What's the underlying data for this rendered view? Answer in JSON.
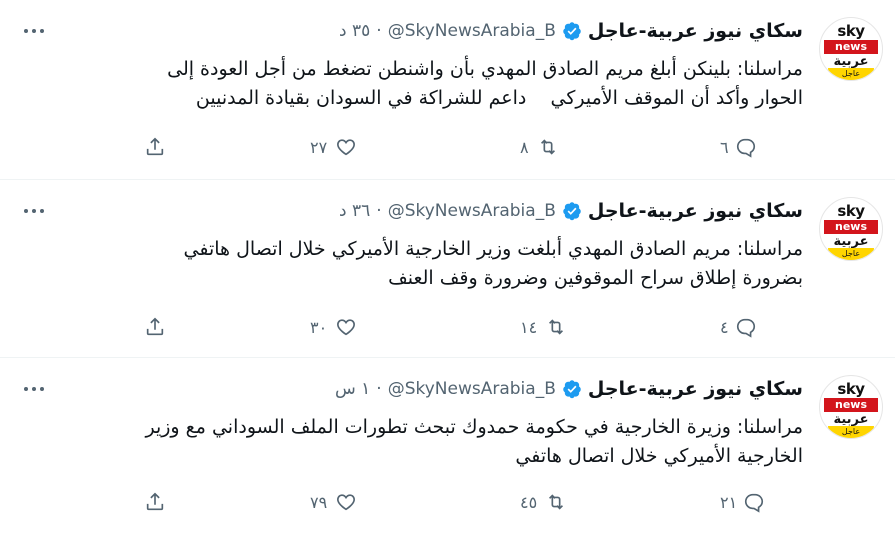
{
  "tweets": [
    {
      "name": "سكاي نيوز عربية-عاجل",
      "handle": "@SkyNewsArabia_B",
      "separator": "·",
      "time": "٣٥ د",
      "text": "مراسلنا: بلينكن أبلغ مريم الصادق المهدي بأن واشنطن تضغط من أجل العودة إلى\nالحوار وأكد أن الموقف الأميركي    داعم للشراكة في السودان بقيادة المدنيين",
      "replies": "٦",
      "retweets": "٨",
      "likes": "٢٧"
    },
    {
      "name": "سكاي نيوز عربية-عاجل",
      "handle": "@SkyNewsArabia_B",
      "separator": "·",
      "time": "٣٦ د",
      "text": "مراسلنا: مريم الصادق المهدي أبلغت وزير الخارجية الأميركي خلال اتصال هاتفي\nبضرورة إطلاق سراح الموقوفين وضرورة وقف العنف",
      "replies": "٤",
      "retweets": "١٤",
      "likes": "٣٠"
    },
    {
      "name": "سكاي نيوز عربية-عاجل",
      "handle": "@SkyNewsArabia_B",
      "separator": "·",
      "time": "١ س",
      "text": "مراسلنا: وزيرة الخارجية في حكومة حمدوك تبحث تطورات الملف السوداني مع وزير\nالخارجية الأميركي خلال اتصال هاتفي",
      "replies": "٢١",
      "retweets": "٤٥",
      "likes": "٧٩"
    }
  ],
  "avatar": {
    "brand_top": "sky",
    "brand_mid": "news",
    "brand_arabic": "عربية",
    "brand_urgent": "عاجل"
  },
  "icons": {
    "verified": "verified-badge-icon",
    "more": "more-dots-icon",
    "reply": "reply-bubble-icon",
    "retweet": "retweet-icon",
    "like": "heart-icon",
    "share": "share-icon"
  },
  "colors": {
    "verified": "#1d9bf0",
    "muted": "#536471",
    "brand_red": "#d3151c",
    "brand_yellow": "#ffd500"
  }
}
